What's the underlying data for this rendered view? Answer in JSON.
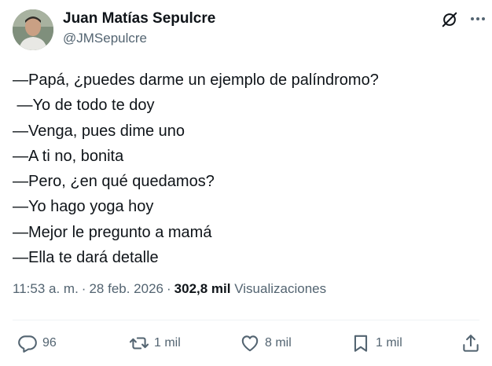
{
  "author": {
    "name": "Juan Matías Sepulcre",
    "handle": "@JMSepulcre"
  },
  "header_icons": [
    "grok-icon",
    "more-icon"
  ],
  "tweet": {
    "lines": [
      "—Papá, ¿puedes darme un ejemplo de palíndromo?",
      " —Yo de todo te doy",
      "—Venga, pues dime uno",
      "—A ti no, bonita",
      "—Pero, ¿en qué quedamos?",
      "—Yo hago yoga hoy",
      "—Mejor le pregunto a mamá",
      "—Ella te dará detalle"
    ]
  },
  "meta": {
    "time": "11:53 a. m.",
    "separator": "·",
    "date": "28 feb. 2026",
    "views_count": "302,8 mil",
    "views_label": "Visualizaciones"
  },
  "actions": {
    "replies": "96",
    "reposts": "1 mil",
    "likes": "8 mil",
    "bookmarks": "1 mil"
  },
  "colors": {
    "text": "#0f1419",
    "secondary": "#536471",
    "divider": "#eff3f4"
  }
}
